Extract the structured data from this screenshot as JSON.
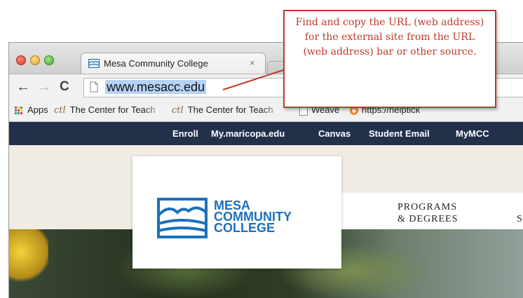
{
  "browser": {
    "tab": {
      "title": "Mesa Community College",
      "close": "×"
    },
    "nav": {
      "back": "←",
      "forward": "→",
      "reload": "C"
    },
    "address_bar": {
      "url": "www.mesacc.edu"
    },
    "bookmarks": [
      {
        "label": "Apps"
      },
      {
        "label": "The Center for Teach"
      },
      {
        "label": "The Center for Teach"
      },
      {
        "label": "Weave"
      },
      {
        "label": "https://helptick"
      }
    ]
  },
  "site": {
    "nav_items": [
      "Enroll",
      "My.maricopa.edu",
      "Canvas",
      "Student Email",
      "MyMCC"
    ],
    "logo_lines": [
      "MESA",
      "COMMUNITY",
      "COLLEGE"
    ],
    "menu": {
      "programs_line1": "PROGRAMS",
      "programs_line2": "& DEGREES",
      "next_initial": "S"
    }
  },
  "callout": {
    "text": "Find and copy the URL (web address) for the external site from the URL (web address) bar or other source."
  },
  "colors": {
    "callout": "#c0392b",
    "site_nav": "#22304a",
    "logo_blue": "#1a70bd",
    "url_highlight": "#b6d3f6"
  }
}
